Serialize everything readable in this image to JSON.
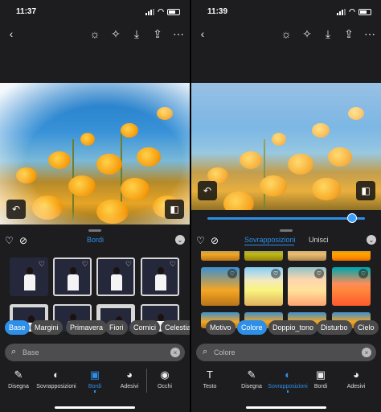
{
  "left": {
    "time": "11:37",
    "panel_title": "Bordi",
    "chips": [
      "Base",
      "Margini",
      "Primavera",
      "Fiori",
      "Cornici",
      "Celestiali"
    ],
    "search_placeholder": "Base",
    "bottom_tabs": [
      "Disegna",
      "Sovrapposizioni",
      "Bordi",
      "Adesivi",
      "Occhi"
    ],
    "active_tab": "Bordi"
  },
  "right": {
    "time": "11:39",
    "panel_tabs": [
      "Sovrapposizioni",
      "Unisci"
    ],
    "chips": [
      "Motivo",
      "Colore",
      "Doppio_tono",
      "Disturbo",
      "Cielo"
    ],
    "search_placeholder": "Colore",
    "bottom_tabs": [
      "Testo",
      "Disegna",
      "Sovrapposizioni",
      "Bordi",
      "Adesivi"
    ],
    "active_tab": "Sovrapposizioni",
    "slider_value": 0.92
  },
  "colors": {
    "accent": "#2d8fe8",
    "background": "#1d1d1f"
  },
  "icons": [
    "back-arrow-icon",
    "bulb-icon",
    "magic-wand-icon",
    "download-icon",
    "share-icon",
    "more-icon",
    "undo-icon",
    "compare-icon",
    "heart-icon",
    "no-icon",
    "chevron-down-icon",
    "search-icon",
    "clear-icon",
    "brush-icon",
    "overlay-icon",
    "border-icon",
    "sticker-icon",
    "eye-icon",
    "text-icon"
  ]
}
